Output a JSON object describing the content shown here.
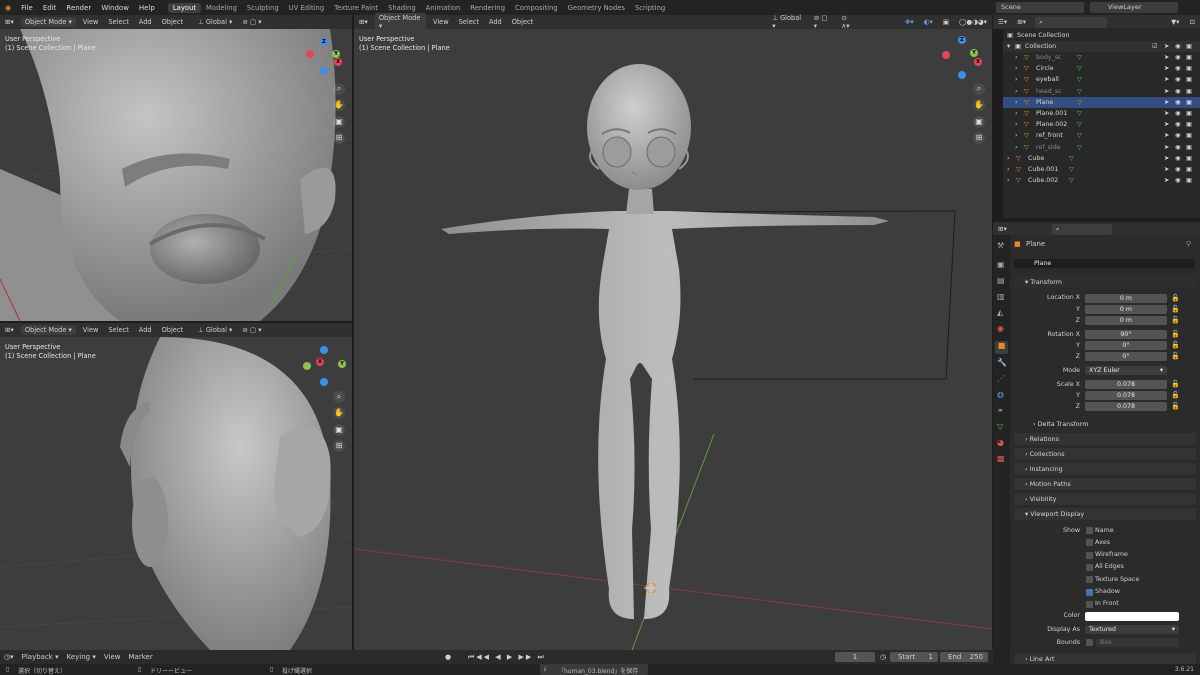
{
  "menu": [
    "File",
    "Edit",
    "Render",
    "Window",
    "Help"
  ],
  "workspaces": [
    "Layout",
    "Modeling",
    "Sculpting",
    "UV Editing",
    "Texture Paint",
    "Shading",
    "Animation",
    "Rendering",
    "Compositing",
    "Geometry Nodes",
    "Scripting"
  ],
  "scene": "Scene",
  "view_layer": "ViewLayer",
  "vp_header": {
    "mode": "Object Mode",
    "view": "View",
    "select": "Select",
    "add": "Add",
    "object": "Object",
    "orient": "Global"
  },
  "overlay": {
    "line1": "User Perspective",
    "line2": "(1) Scene Collection | Plane"
  },
  "axes": {
    "x": "X",
    "y": "Y",
    "z": "Z"
  },
  "outliner": {
    "root": "Scene Collection",
    "collection": "Collection",
    "items": [
      "body_sc",
      "Circle",
      "eyeball",
      "head_sc",
      "Plane",
      "Plane.001",
      "Plane.002",
      "ref_front",
      "ref_side",
      "Cube",
      "Cube.001",
      "Cube.002"
    ]
  },
  "props": {
    "object": "Plane",
    "datablock": "Plane",
    "transform": "Transform",
    "location_label": "Location X",
    "rotation_label": "Rotation X",
    "scale_label": "Scale X",
    "y": "Y",
    "z": "Z",
    "loc": [
      "0 m",
      "0 m",
      "0 m"
    ],
    "rot": [
      "90°",
      "0°",
      "0°"
    ],
    "scl": [
      "0.078",
      "0.078",
      "0.078"
    ],
    "mode_label": "Mode",
    "mode": "XYZ Euler",
    "panels": [
      "Delta Transform",
      "Relations",
      "Collections",
      "Instancing",
      "Motion Paths",
      "Visibility",
      "Viewport Display"
    ],
    "show": "Show",
    "checks": [
      "Name",
      "Axes",
      "Wireframe",
      "All Edges",
      "Texture Space",
      "Shadow",
      "In Front"
    ],
    "color_label": "Color",
    "display_as_label": "Display As",
    "display_as": "Textured",
    "bounds_label": "Bounds",
    "bounds": "Box",
    "line_art": "Line Art"
  },
  "timeline": {
    "playback": "Playback",
    "keying": "Keying",
    "view": "View",
    "marker": "Marker",
    "frame": "1",
    "start_label": "Start",
    "start": "1",
    "end_label": "End",
    "end": "250"
  },
  "status": {
    "s1": "選択（切り替え）",
    "s2": "ドリーービュー",
    "s3": "投げ縄選択",
    "msg": "「human_03.blend」を保存",
    "version": "3.6.21"
  },
  "colors": {
    "x": "#e8435a",
    "y": "#8bc34a",
    "z": "#3f8ee8",
    "accent": "#4772b3"
  }
}
